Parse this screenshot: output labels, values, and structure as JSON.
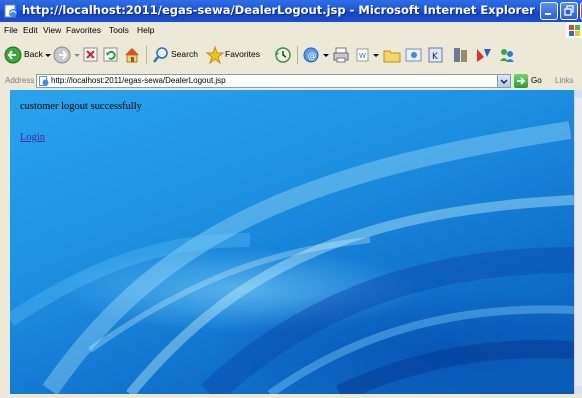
{
  "window": {
    "title": "http://localhost:2011/egas-sewa/DealerLogout.jsp - Microsoft Internet Explorer"
  },
  "menu": {
    "items": [
      "File",
      "Edit",
      "View",
      "Favorites",
      "Tools",
      "Help"
    ]
  },
  "toolbar": {
    "back_label": "Back",
    "search_label": "Search",
    "favorites_label": "Favorites"
  },
  "address": {
    "label": "Address",
    "url": "http://localhost:2011/egas-sewa/DealerLogout.jsp",
    "go_label": "Go",
    "links_label": "Links"
  },
  "page": {
    "message": "customer logout successfully",
    "login_link": "Login"
  },
  "colors": {
    "titlebar": "#1f57d6",
    "chrome": "#ece9d8",
    "link": "#3a2f9c",
    "background_blue": "#1f93e3"
  }
}
